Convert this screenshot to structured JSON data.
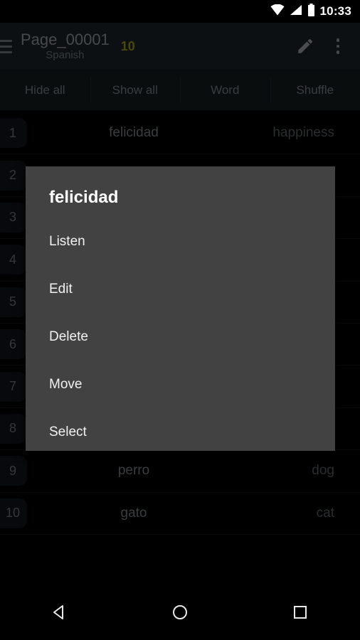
{
  "status_bar": {
    "time": "10:33",
    "icons": [
      "wifi-icon",
      "cell-signal-icon",
      "battery-icon"
    ]
  },
  "app_bar": {
    "menu_icon": "hamburger-menu-icon",
    "title": "Page_00001",
    "subtitle": "Spanish",
    "count": "10",
    "count_color": "#c0b82a",
    "edit_icon": "pencil-edit-icon",
    "overflow_icon": "overflow-menu-icon"
  },
  "toolbar": {
    "buttons": [
      {
        "label": "Hide all"
      },
      {
        "label": "Show all"
      },
      {
        "label": "Word"
      },
      {
        "label": "Shuffle"
      }
    ]
  },
  "word_list": {
    "rows": [
      {
        "num": "1",
        "source": "felicidad",
        "target": "happiness"
      },
      {
        "num": "2",
        "source": "",
        "target": ""
      },
      {
        "num": "3",
        "source": "",
        "target": ""
      },
      {
        "num": "4",
        "source": "",
        "target": ""
      },
      {
        "num": "5",
        "source": "",
        "target": ""
      },
      {
        "num": "6",
        "source": "",
        "target": ""
      },
      {
        "num": "7",
        "source": "",
        "target": ""
      },
      {
        "num": "8",
        "source": "",
        "target": ""
      },
      {
        "num": "9",
        "source": "perro",
        "target": "dog"
      },
      {
        "num": "10",
        "source": "gato",
        "target": "cat"
      }
    ]
  },
  "dialog": {
    "title": "felicidad",
    "background": "#424242",
    "items": [
      {
        "label": "Listen"
      },
      {
        "label": "Edit"
      },
      {
        "label": "Delete"
      },
      {
        "label": "Move"
      },
      {
        "label": "Select"
      }
    ]
  },
  "nav_bar": {
    "back_icon": "back-triangle-icon",
    "home_icon": "home-circle-icon",
    "recents_icon": "recents-square-icon"
  }
}
